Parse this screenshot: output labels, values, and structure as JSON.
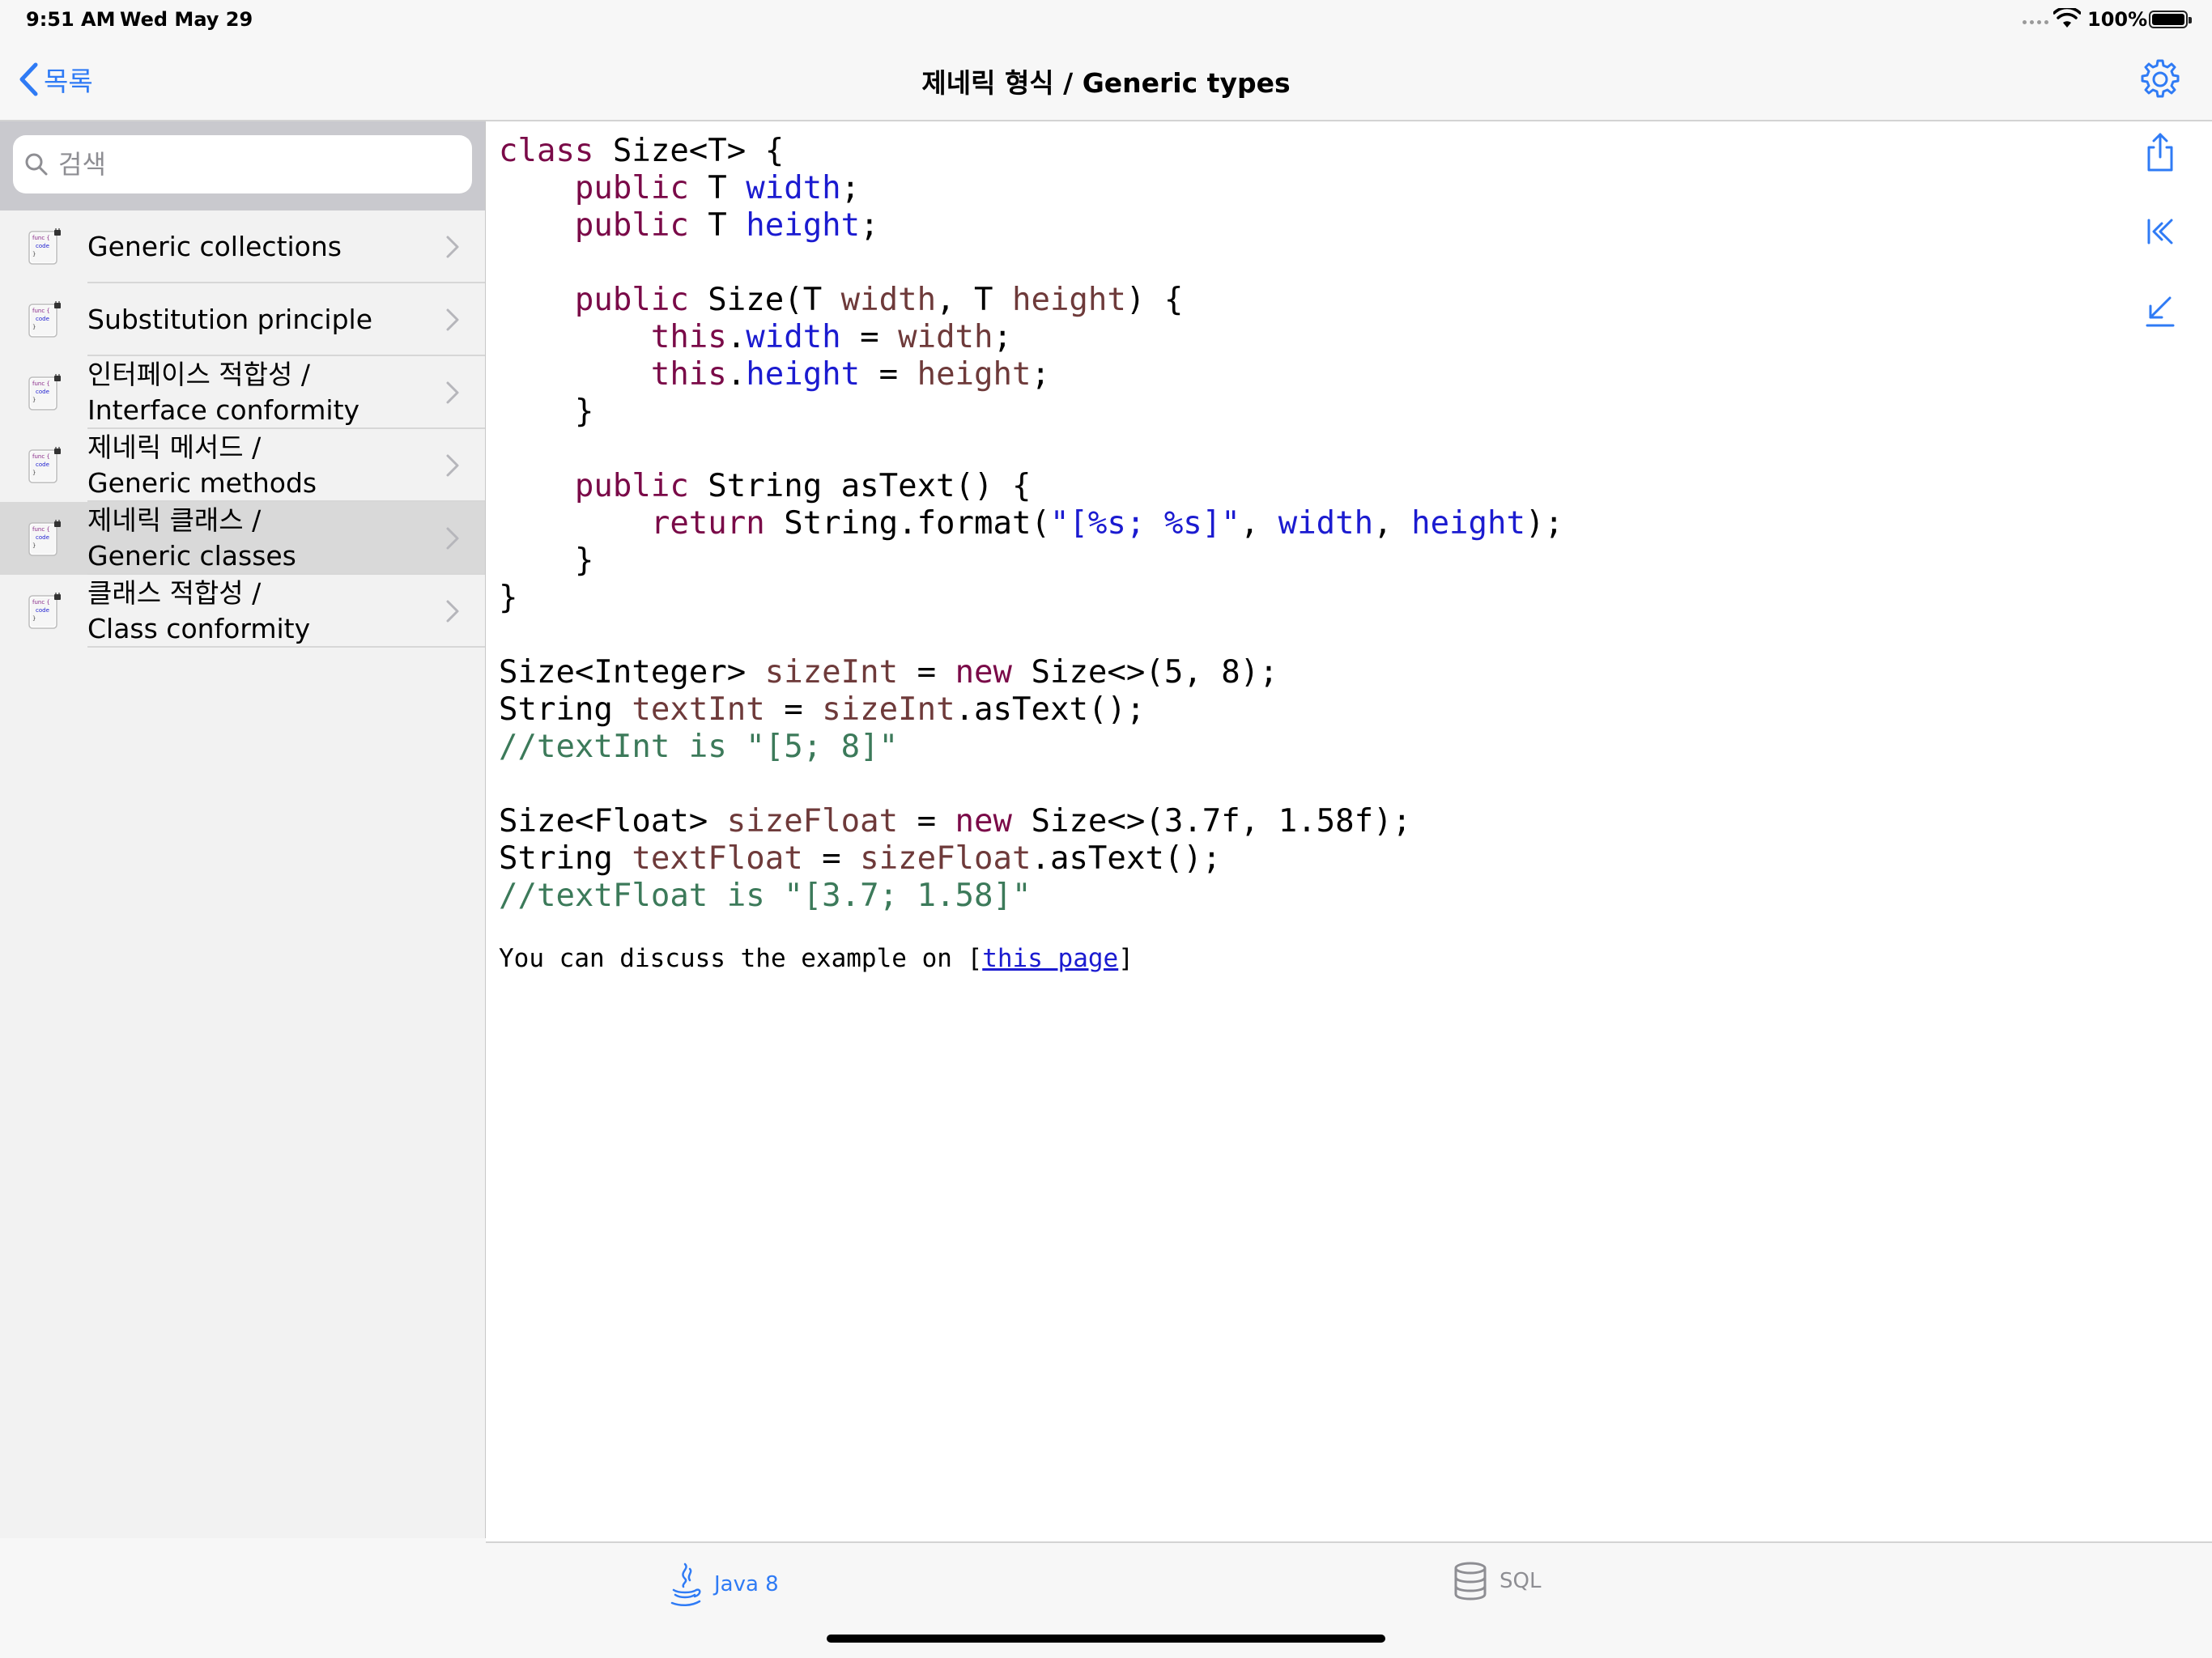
{
  "status_bar": {
    "time": "9:51 AM",
    "date": "Wed May 29",
    "battery": "100%"
  },
  "nav": {
    "back_label": "목록",
    "title": "제네릭 형식 / Generic types"
  },
  "search": {
    "placeholder": "검색"
  },
  "sidebar": {
    "items": [
      {
        "line1": "Generic collections",
        "line2": ""
      },
      {
        "line1": "Substitution principle",
        "line2": ""
      },
      {
        "line1": "인터페이스 적합성 /",
        "line2": "Interface conformity"
      },
      {
        "line1": "제네릭 메서드 /",
        "line2": "Generic methods"
      },
      {
        "line1": "제네릭 클래스 /",
        "line2": "Generic classes"
      },
      {
        "line1": "클래스 적합성 /",
        "line2": "Class conformity"
      }
    ],
    "selected_index": 4,
    "thumb_text": [
      "func {",
      "code",
      "}"
    ]
  },
  "code": {
    "class_kw": "class",
    "class_decl": " Size<T> {",
    "public1": "public",
    "t1": " T ",
    "width_field": "width",
    "semi1": ";",
    "public2": "public",
    "t2": " T ",
    "height_field": "height",
    "semi2": ";",
    "public3": "public",
    "ctor_start": " Size(T ",
    "ctor_width": "width",
    "ctor_mid": ", T ",
    "ctor_height": "height",
    "ctor_end": ") {",
    "this1": "this",
    "dot1": ".",
    "this_width": "width",
    "eq1": " = ",
    "rhs_width": "width",
    "semi3": ";",
    "this2": "this",
    "dot2": ".",
    "this_height": "height",
    "eq2": " = ",
    "rhs_height": "height",
    "semi4": ";",
    "close1": "}",
    "public4": "public",
    "astext_decl": " String asText() {",
    "return_kw": "return",
    "format_call": " String.format(",
    "format_str": "\"[%s; %s]\"",
    "comma1": ", ",
    "fmt_width": "width",
    "comma2": ", ",
    "fmt_height": "height",
    "format_end": ");",
    "close2": "}",
    "close3": "}",
    "int_type": "Size<Integer> ",
    "int_var": "sizeInt",
    "int_eq": " = ",
    "new1": "new",
    "int_ctor": " Size<>(5, 8);",
    "str_type1": "String ",
    "text_int": "textInt",
    "str_eq1": " = ",
    "size_int_ref": "sizeInt",
    "astext_call1": ".asText();",
    "comment1": "//textInt is \"[5; 8]\"",
    "float_type": "Size<Float> ",
    "float_var": "sizeFloat",
    "float_eq": " = ",
    "new2": "new",
    "float_ctor": " Size<>(3.7f, 1.58f);",
    "str_type2": "String ",
    "text_float": "textFloat",
    "str_eq2": " = ",
    "size_float_ref": "sizeFloat",
    "astext_call2": ".asText();",
    "comment2": "//textFloat is \"[3.7; 1.58]\""
  },
  "discuss": {
    "prefix": "You can discuss the example on [",
    "link": "this page",
    "suffix": "]"
  },
  "tabs": {
    "java": "Java 8",
    "sql": "SQL"
  },
  "colors": {
    "accent": "#2f7bf5",
    "keyword": "#7a0a48",
    "field": "#1b1bd0",
    "variable": "#6e3a3a",
    "comment": "#3c7a5a",
    "selected_row": "#d9d9d9"
  }
}
